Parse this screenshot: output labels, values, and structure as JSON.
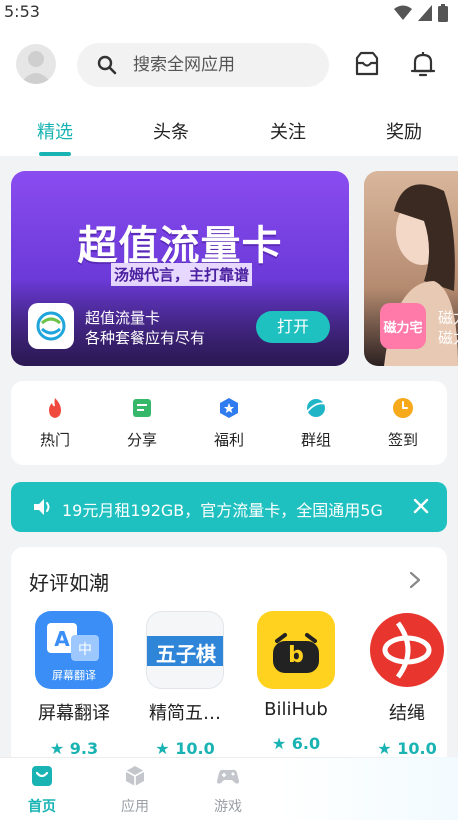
{
  "status_bar": {
    "time": "5:53"
  },
  "search": {
    "placeholder": "搜索全网应用"
  },
  "tabs": [
    {
      "label": "精选",
      "active": true
    },
    {
      "label": "头条",
      "active": false
    },
    {
      "label": "关注",
      "active": false
    },
    {
      "label": "奖励",
      "active": false
    }
  ],
  "banners": [
    {
      "headline": "超值流量卡",
      "slogan": "汤姆代言，主打靠谱",
      "app_name": "超值流量卡",
      "app_desc": "各种套餐应有尽有",
      "button_label": "打开"
    },
    {
      "icon_text": "磁力宅",
      "app_name": "磁力",
      "app_desc": "磁力"
    }
  ],
  "shortcuts": [
    {
      "label": "热门",
      "icon": "flame-icon",
      "color": "#f04a3e"
    },
    {
      "label": "分享",
      "icon": "share-icon",
      "color": "#35b86a"
    },
    {
      "label": "福利",
      "icon": "star-badge-icon",
      "color": "#2f7cf0"
    },
    {
      "label": "群组",
      "icon": "planet-icon",
      "color": "#1fb5c6"
    },
    {
      "label": "签到",
      "icon": "clock-icon",
      "color": "#f7a91c"
    }
  ],
  "notice": {
    "text": "19元月租192GB，官方流量卡，全国通用5G"
  },
  "recommend": {
    "title": "好评如潮",
    "apps": [
      {
        "name": "屏幕翻译",
        "rating": "9.3",
        "icon_text": "屏幕翻译"
      },
      {
        "name": "精简五…",
        "rating": "10.0",
        "icon_text": "五子棋"
      },
      {
        "name": "BiliHub",
        "rating": "6.0",
        "icon_text": "b"
      },
      {
        "name": "结绳",
        "rating": "10.0",
        "icon_text": ""
      }
    ]
  },
  "bottom_nav": [
    {
      "label": "首页",
      "active": true
    },
    {
      "label": "应用",
      "active": false
    },
    {
      "label": "游戏",
      "active": false
    }
  ],
  "colors": {
    "accent": "#1ab3b3",
    "notice_bg": "#1fc0c0"
  }
}
